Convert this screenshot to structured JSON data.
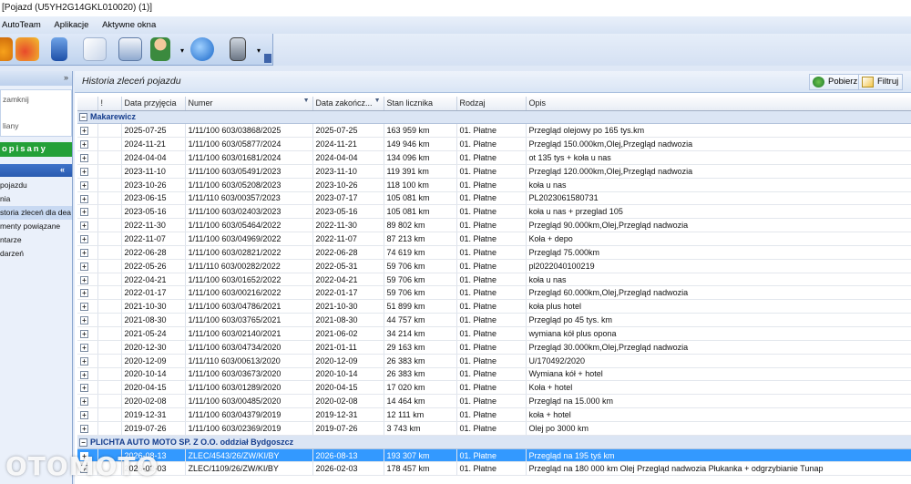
{
  "window": {
    "title": "[Pojazd (U5YH2G14GKL010020) (1)]"
  },
  "menu": [
    "AutoTeam",
    "Aplikacje",
    "Aktywne okna"
  ],
  "toolbar_icons": [
    "car-icon",
    "cars-icon",
    "book-icon",
    "document-icon",
    "crm-icon",
    "user-icon",
    "dropdown-arrow",
    "globe-icon",
    "phone-icon",
    "dropdown-arrow"
  ],
  "sidebar": {
    "box_line1": "zamknij",
    "box_line2": "liany",
    "status_label": "opisany",
    "items": [
      "pojazdu",
      "nia",
      "storia zleceń dla dea",
      "menty powiązane",
      "ntarze",
      "darzeń"
    ]
  },
  "main": {
    "title": "Historia zleceń pojazdu",
    "buttons": {
      "fetch": "Pobierz",
      "filter": "Filtruj"
    }
  },
  "table": {
    "columns": [
      "",
      "!",
      "Data przyjęcia",
      "Numer",
      "Data zakończ...",
      "Stan licznika",
      "Rodzaj",
      "Opis"
    ],
    "groups": [
      {
        "name": "Makarewicz",
        "rows": [
          [
            "2025-07-25",
            "1/11/100 603/03868/2025",
            "2025-07-25",
            "163 959 km",
            "01. Płatne",
            "Przegląd olejowy po 165 tys.km"
          ],
          [
            "2024-11-21",
            "1/11/100 603/05877/2024",
            "2024-11-21",
            "149 946 km",
            "01. Płatne",
            "Przegląd 150.000km,Olej,Przegląd nadwozia"
          ],
          [
            "2024-04-04",
            "1/11/100 603/01681/2024",
            "2024-04-04",
            "134 096 km",
            "01. Płatne",
            "ot 135 tys + koła u nas"
          ],
          [
            "2023-11-10",
            "1/11/100 603/05491/2023",
            "2023-11-10",
            "119 391 km",
            "01. Płatne",
            "Przegląd 120.000km,Olej,Przegląd nadwozia"
          ],
          [
            "2023-10-26",
            "1/11/100 603/05208/2023",
            "2023-10-26",
            "118 100 km",
            "01. Płatne",
            "koła u nas"
          ],
          [
            "2023-06-15",
            "1/11/110 603/00357/2023",
            "2023-07-17",
            "105 081 km",
            "01. Płatne",
            "PL2023061580731"
          ],
          [
            "2023-05-16",
            "1/11/100 603/02403/2023",
            "2023-05-16",
            "105 081 km",
            "01. Płatne",
            "koła u nas + przeglad 105"
          ],
          [
            "2022-11-30",
            "1/11/100 603/05464/2022",
            "2022-11-30",
            "89 802 km",
            "01. Płatne",
            "Przegląd 90.000km,Olej,Przegląd nadwozia"
          ],
          [
            "2022-11-07",
            "1/11/100 603/04969/2022",
            "2022-11-07",
            "87 213 km",
            "01. Płatne",
            "Koła + depo"
          ],
          [
            "2022-06-28",
            "1/11/100 603/02821/2022",
            "2022-06-28",
            "74 619 km",
            "01. Płatne",
            "Przegląd 75.000km"
          ],
          [
            "2022-05-26",
            "1/11/110 603/00282/2022",
            "2022-05-31",
            "59 706 km",
            "01. Płatne",
            "pl2022040100219"
          ],
          [
            "2022-04-21",
            "1/11/100 603/01652/2022",
            "2022-04-21",
            "59 706 km",
            "01. Płatne",
            "koła u nas"
          ],
          [
            "2022-01-17",
            "1/11/100 603/00216/2022",
            "2022-01-17",
            "59 706 km",
            "01. Płatne",
            "Przegląd 60.000km,Olej,Przegląd nadwozia"
          ],
          [
            "2021-10-30",
            "1/11/100 603/04786/2021",
            "2021-10-30",
            "51 899 km",
            "01. Płatne",
            "koła plus hotel"
          ],
          [
            "2021-08-30",
            "1/11/100 603/03765/2021",
            "2021-08-30",
            "44 757 km",
            "01. Płatne",
            "Przegląd po 45 tys. km"
          ],
          [
            "2021-05-24",
            "1/11/100 603/02140/2021",
            "2021-06-02",
            "34 214 km",
            "01. Płatne",
            "wymiana kół plus opona"
          ],
          [
            "2020-12-30",
            "1/11/100 603/04734/2020",
            "2021-01-11",
            "29 163 km",
            "01. Płatne",
            "Przegląd 30.000km,Olej,Przegląd nadwozia"
          ],
          [
            "2020-12-09",
            "1/11/110 603/00613/2020",
            "2020-12-09",
            "26 383 km",
            "01. Płatne",
            "U/170492/2020"
          ],
          [
            "2020-10-14",
            "1/11/100 603/03673/2020",
            "2020-10-14",
            "26 383 km",
            "01. Płatne",
            "Wymiana kół + hotel"
          ],
          [
            "2020-04-15",
            "1/11/100 603/01289/2020",
            "2020-04-15",
            "17 020 km",
            "01. Płatne",
            "Koła + hotel"
          ],
          [
            "2020-02-08",
            "1/11/100 603/00485/2020",
            "2020-02-08",
            "14 464 km",
            "01. Płatne",
            "Przegląd na 15.000 km"
          ],
          [
            "2019-12-31",
            "1/11/100 603/04379/2019",
            "2019-12-31",
            "12 111 km",
            "01. Płatne",
            "koła + hotel"
          ],
          [
            "2019-07-26",
            "1/11/100 603/02369/2019",
            "2019-07-26",
            "3 743 km",
            "01. Płatne",
            "Olej po 3000 km"
          ]
        ]
      },
      {
        "name": "PLICHTA AUTO MOTO SP. Z O.O. oddział Bydgoszcz",
        "rows": [
          [
            "2026-08-13",
            "ZLEC/4543/26/ZW/KI/BY",
            "2026-08-13",
            "193 307 km",
            "01. Płatne",
            "Przegląd na 195 tyś km"
          ],
          [
            "2026-02-03",
            "ZLEC/1109/26/ZW/KI/BY",
            "2026-02-03",
            "178 457 km",
            "01. Płatne",
            "Przegląd na 180 000 km Olej Przegląd nadwozia  Płukanka + odgrzybianie Tunap"
          ]
        ]
      }
    ],
    "selected": {
      "group": 1,
      "row": 0
    }
  },
  "watermark": "OTOMOTO",
  "colors": {
    "selected_row": "#3399ff",
    "group_header_text": "#143c8c",
    "status_green": "#24a038"
  }
}
